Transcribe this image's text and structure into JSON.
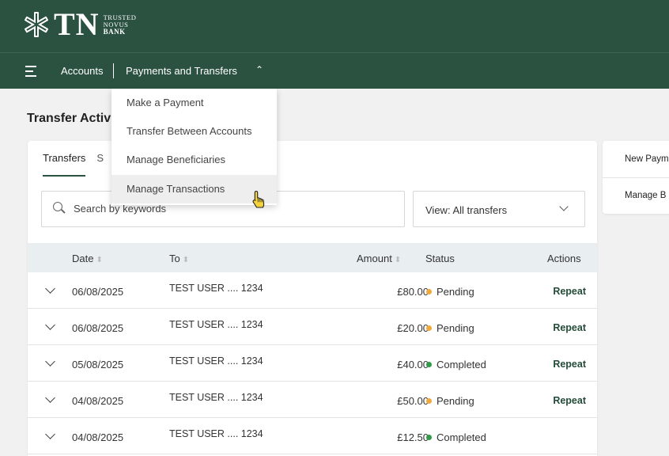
{
  "brand": {
    "logo_letters": "TN",
    "line1": "TRUSTED",
    "line2": "NOVUS",
    "line3": "BANK"
  },
  "nav": {
    "accounts": "Accounts",
    "payments": "Payments and Transfers",
    "menu_icon": "hamburger-icon",
    "caret_icon": "chevron-up-icon"
  },
  "dropdown": {
    "items": [
      {
        "label": "Make a Payment"
      },
      {
        "label": "Transfer Between Accounts"
      },
      {
        "label": "Manage Beneficiaries"
      },
      {
        "label": "Manage Transactions"
      }
    ],
    "hovered_index": 3
  },
  "page": {
    "title": "Transfer Activ"
  },
  "tabs": {
    "active": "Transfers",
    "inactive": "S"
  },
  "search": {
    "placeholder": "Search by keywords",
    "icon": "search-icon"
  },
  "view": {
    "label": "View:  All transfers",
    "icon": "chevron-down-icon"
  },
  "table": {
    "headers": {
      "date": "Date",
      "to": "To",
      "amount": "Amount",
      "status": "Status",
      "actions": "Actions"
    },
    "rows": [
      {
        "date": "06/08/2025",
        "to": "TEST USER .... 1234",
        "amount": "£80.00",
        "status": "Pending",
        "action": "Repeat"
      },
      {
        "date": "06/08/2025",
        "to": "TEST USER .... 1234",
        "amount": "£20.00",
        "status": "Pending",
        "action": "Repeat"
      },
      {
        "date": "05/08/2025",
        "to": "TEST USER .... 1234",
        "amount": "£40.00",
        "status": "Completed",
        "action": "Repeat"
      },
      {
        "date": "04/08/2025",
        "to": "TEST USER .... 1234",
        "amount": "£50.00",
        "status": "Pending",
        "action": "Repeat"
      },
      {
        "date": "04/08/2025",
        "to": "TEST USER .... 1234",
        "amount": "£12.50",
        "status": "Completed",
        "action": ""
      }
    ]
  },
  "side": {
    "link1": "New Paym",
    "link2": "Manage B"
  },
  "colors": {
    "brand_green": "#2b5240",
    "pending": "#f0a93b",
    "completed": "#2f9a47"
  }
}
